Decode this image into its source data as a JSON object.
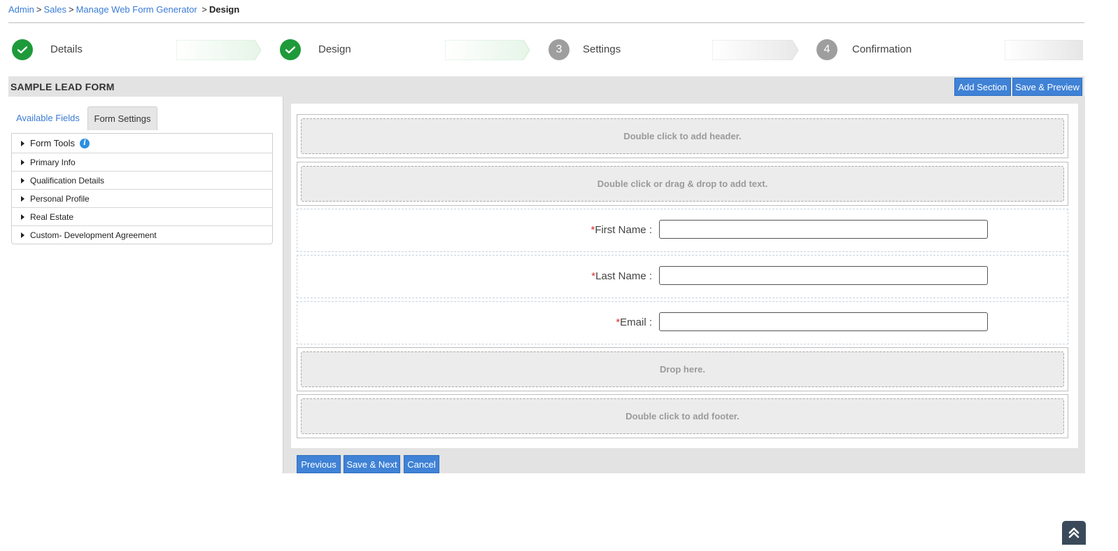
{
  "breadcrumb": {
    "items": [
      "Admin",
      "Sales",
      "Manage Web Form Generator"
    ],
    "current": "Design",
    "separator": ">"
  },
  "wizard": {
    "steps": [
      {
        "label": "Details",
        "state": "done",
        "number": ""
      },
      {
        "label": "Design",
        "state": "done",
        "number": ""
      },
      {
        "label": "Settings",
        "state": "todo",
        "number": "3"
      },
      {
        "label": "Confirmation",
        "state": "todo",
        "number": "4"
      }
    ]
  },
  "form": {
    "title": "SAMPLE LEAD FORM",
    "add_section_label": "Add Section",
    "save_preview_label": "Save & Preview"
  },
  "left_panel": {
    "tabs": [
      "Available Fields",
      "Form Settings"
    ],
    "accordion": [
      "Form Tools",
      "Primary Info",
      "Qualification Details",
      "Personal Profile",
      "Real Estate",
      "Custom- Development Agreement"
    ]
  },
  "canvas": {
    "header_placeholder": "Double click to add header.",
    "text_placeholder": "Double click or drag & drop to add text.",
    "fields": [
      {
        "label": "First Name :",
        "required": "*",
        "value": ""
      },
      {
        "label": "Last Name :",
        "required": "*",
        "value": ""
      },
      {
        "label": "Email :",
        "required": "*",
        "value": ""
      }
    ],
    "drop_placeholder": "Drop here.",
    "footer_placeholder": "Double click to add footer."
  },
  "footer_buttons": {
    "previous": "Previous",
    "save_next": "Save & Next",
    "cancel": "Cancel"
  },
  "colors": {
    "accent": "#3f82d6",
    "link": "#3a7bd5",
    "done": "#1e9a3a",
    "todo": "#9e9e9e",
    "required": "#d9302c"
  }
}
